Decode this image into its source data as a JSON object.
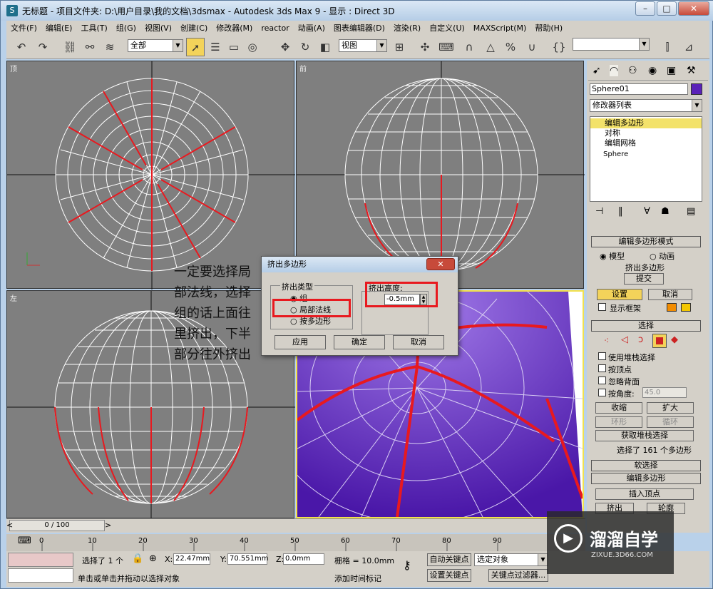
{
  "window": {
    "title": "无标题    - 项目文件夹: D:\\用户目录\\我的文档\\3dsmax    - Autodesk 3ds Max 9    - 显示 : Direct 3D",
    "btn_min": "–",
    "btn_max": "□",
    "btn_close": "✕"
  },
  "menu": [
    "文件(F)",
    "编辑(E)",
    "工具(T)",
    "组(G)",
    "视图(V)",
    "创建(C)",
    "修改器(M)",
    "reactor",
    "动画(A)",
    "图表编辑器(D)",
    "渲染(R)",
    "自定义(U)",
    "MAXScript(M)",
    "帮助(H)"
  ],
  "toolbar": {
    "filter": "全部",
    "ref_coord": "视图"
  },
  "viewports": {
    "top": "顶",
    "front": "前",
    "left": "左"
  },
  "cmd": {
    "object_name": "Sphere01",
    "modifier_list": "修改器列表",
    "stack": [
      "编辑多边形",
      "对称",
      "编辑网格",
      "Sphere"
    ],
    "rollout_mode": "编辑多边形模式",
    "mode_model": "模型",
    "mode_anim": "动画",
    "extrude_poly": "挤出多边形",
    "commit": "提交",
    "settings": "设置",
    "cancel": "取消",
    "show_cage": "显示框架",
    "rollout_select": "选择",
    "use_stack": "使用堆栈选择",
    "by_vertex": "按顶点",
    "ignore_back": "忽略背面",
    "by_angle": "按角度:",
    "angle_value": "45.0",
    "shrink": "收缩",
    "grow": "扩大",
    "ring": "环形",
    "loop": "循环",
    "get_stack": "获取堆栈选择",
    "selected_info": "选择了 161 个多边形",
    "soft_sel": "软选择",
    "rollout_edit": "编辑多边形",
    "insert_vertex": "插入顶点",
    "extrude": "挤出",
    "outline": "轮廓"
  },
  "dialog": {
    "title": "挤出多边形",
    "type_group": "挤出类型",
    "opt_group": "组",
    "opt_local": "局部法线",
    "opt_by_poly": "按多边形",
    "height_label": "挤出高度:",
    "height_value": "-0.5mm",
    "apply": "应用",
    "ok": "确定",
    "cancel": "取消",
    "close": "✕"
  },
  "annotation": "一定要选择局部法线，选择组的话上面往里挤出，下半部分往外挤出",
  "timeline": {
    "frame": "0 / 100",
    "ticks": [
      "0",
      "10",
      "20",
      "30",
      "40",
      "50",
      "60",
      "70",
      "80",
      "90"
    ]
  },
  "status": {
    "selected": "选择了 1 个",
    "x_label": "X:",
    "x_value": "22.47mm",
    "y_label": "Y:",
    "y_value": "70.551mm",
    "z_label": "Z:",
    "z_value": "0.0mm",
    "grid": "栅格 = 10.0mm",
    "auto_key": "自动关键点",
    "selected_obj": "选定对象",
    "set_key": "设置关键点",
    "key_filter": "关键点过滤器...",
    "prompt": "单击或单击并拖动以选择对象",
    "add_time": "添加时间标记"
  },
  "watermark": {
    "brand": "溜溜自学",
    "url": "ZIXUE.3D66.COM"
  },
  "colors": {
    "poly_face": "#5a22b8",
    "selection_red": "#e8191f",
    "viewport_bg": "#7f7f7f"
  }
}
